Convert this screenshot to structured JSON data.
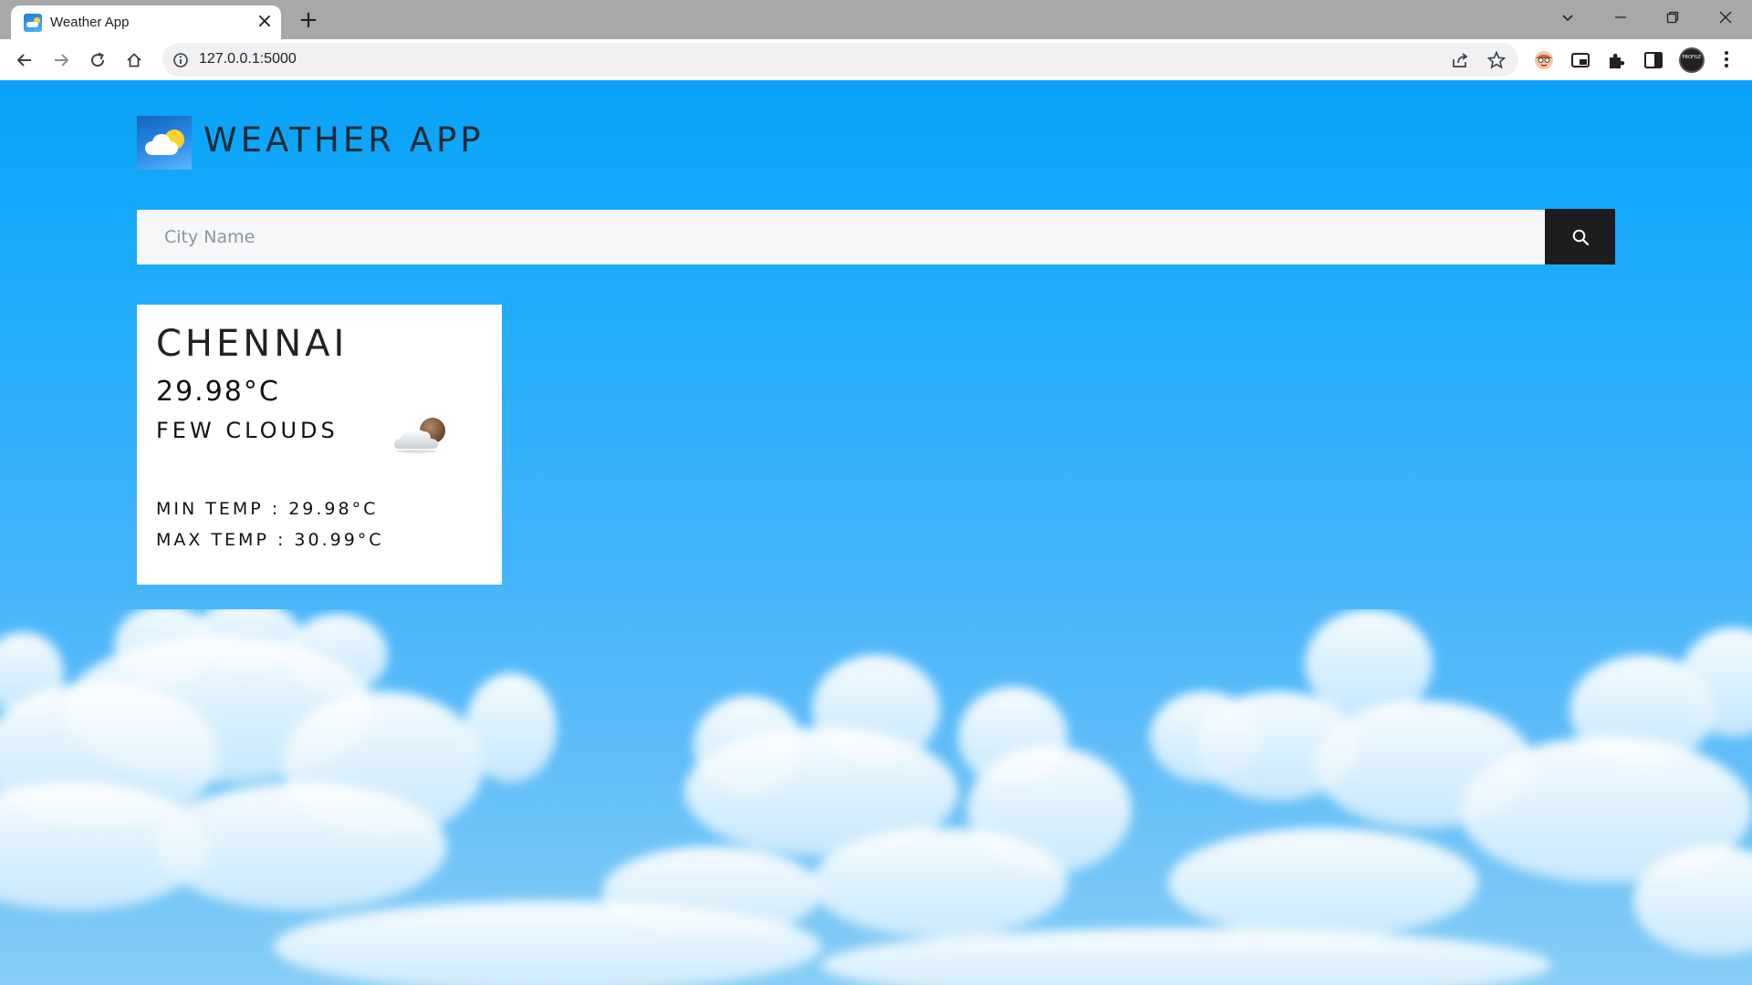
{
  "browser": {
    "tab_title": "Weather App",
    "url": "127.0.0.1:5000",
    "profile_text": "PROFILE"
  },
  "app": {
    "title": "WEATHER APP"
  },
  "search": {
    "placeholder": "City Name",
    "value": ""
  },
  "weather": {
    "city": "CHENNAI",
    "temperature": "29.98°C",
    "description": "FEW CLOUDS",
    "icon": "few-clouds-night-icon",
    "min_temp": "MIN TEMP : 29.98°C",
    "max_temp": "MAX TEMP : 30.99°C"
  },
  "colors": {
    "sky_top": "#07a3f8",
    "search_button": "#1d1d1f",
    "card_background": "#ffffff"
  }
}
